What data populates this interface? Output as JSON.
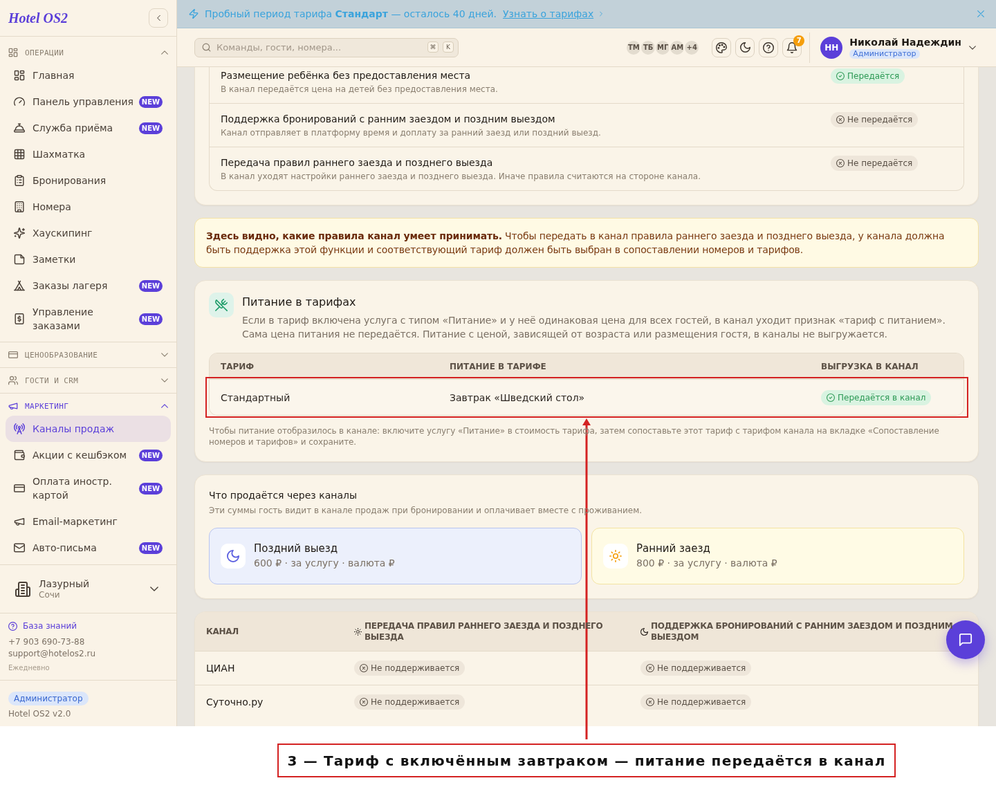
{
  "sidebar": {
    "logo": "Hotel OS2",
    "sections": [
      {
        "title": "ОПЕРАЦИИ",
        "expanded": true,
        "active": false,
        "items": [
          {
            "label": "Главная",
            "selected": false
          },
          {
            "label": "Панель управления",
            "selected": false,
            "badge": "NEW"
          },
          {
            "label": "Служба приёма",
            "selected": false,
            "badge": "NEW"
          },
          {
            "label": "Шахматка",
            "selected": false
          },
          {
            "label": "Бронирования",
            "selected": false
          },
          {
            "label": "Номера",
            "selected": false
          },
          {
            "label": "Хаускипинг",
            "selected": false
          },
          {
            "label": "Заметки",
            "selected": false
          },
          {
            "label": "Заказы лагеря",
            "selected": false,
            "badge": "NEW"
          },
          {
            "label": "Управление заказами",
            "selected": false,
            "badge": "NEW"
          }
        ]
      },
      {
        "title": "ЦЕНООБРАЗОВАНИЕ",
        "expanded": false,
        "active": false
      },
      {
        "title": "ГОСТИ И CRM",
        "expanded": false,
        "active": false
      },
      {
        "title": "МАРКЕТИНГ",
        "expanded": true,
        "active": true,
        "items": [
          {
            "label": "Каналы продаж",
            "selected": true
          },
          {
            "label": "Акции с кешбэком",
            "selected": false,
            "badge": "NEW"
          },
          {
            "label": "Оплата иностр. картой",
            "selected": false,
            "badge": "NEW"
          },
          {
            "label": "Email-маркетинг",
            "selected": false
          },
          {
            "label": "Авто-письма",
            "selected": false,
            "badge": "NEW"
          }
        ]
      }
    ],
    "hotel": {
      "name": "Лазурный",
      "city": "Сочи"
    },
    "support": {
      "link": "База знаний",
      "phone": "+7 903 690-73-88",
      "email": "support@hotelos2.ru",
      "hours": "Ежедневно"
    },
    "footer": {
      "role": "Администратор",
      "version": "Hotel OS2 v2.0"
    }
  },
  "banner": {
    "message": "Пробный период тарифа **Стандарт** — осталось 40 дней.",
    "link": "Узнать о тарифах"
  },
  "topbar": {
    "search": {
      "placeholder": "Команды, гости, номера...",
      "shortcut": [
        "⌘",
        "K"
      ]
    },
    "team": {
      "members": [
        "ТМ",
        "ТБ",
        "МГ",
        "АМ"
      ],
      "more": "+4"
    },
    "notifications": "7",
    "user": {
      "initials": "НН",
      "name": "Николай Надеждин",
      "role": "Администратор"
    }
  },
  "rules": {
    "rows": [
      {
        "title": "Размещение ребёнка без предоставления места",
        "description": "В канал передаётся цена на детей без предоставления места.",
        "status": "Передаётся",
        "transmitted": true
      },
      {
        "title": "Поддержка бронирований с ранним заездом и поздним выездом",
        "description": "Канал отправляет в платформу время и доплату за ранний заезд или поздний выезд.",
        "status": "Не передаётся",
        "transmitted": false
      },
      {
        "title": "Передача правил раннего заезда и позднего выезда",
        "description": "В канал уходят настройки раннего заезда и позднего выезда. Иначе правила считаются на стороне канала.",
        "status": "Не передаётся",
        "transmitted": false
      }
    ]
  },
  "notice": {
    "text": "**Здесь видно, какие правила канал умеет принимать.** Чтобы передать в канал правила раннего заезда и позднего выезда, у канала должна быть поддержка этой функции и соответствующий тариф должен быть выбран в сопоставлении номеров и тарифов."
  },
  "meals": {
    "title": "Питание в тарифах",
    "description": "Если в тариф включена услуга с типом «Питание» и у неё одинаковая цена для всех гостей, в канал уходит признак «тариф с питанием». Сама цена питания не передаётся. Питание с ценой, зависящей от возраста или размещения гостя, в каналы не выгружается.",
    "table": {
      "columns": [
        "ТАРИФ",
        "ПИТАНИЕ В ТАРИФЕ",
        "ВЫГРУЗКА В КАНАЛ"
      ],
      "rows": [
        {
          "tariff": "Стандартный",
          "meal": "Завтрак «Шведский стол»",
          "status": "Передаётся в канал",
          "transmitted": true,
          "highlighted": true
        }
      ]
    },
    "note": "Чтобы питание отобразилось в канале: включите услугу «Питание» в стоимость тарифа, затем сопоставьте этот тариф с тарифом канала на вкладке «Сопоставление номеров и тарифов» и сохраните."
  },
  "sold": {
    "title": "Что продаётся через каналы",
    "subtitle": "Эти суммы гость видит в канале продаж при бронировании и оплачивает вместе с проживанием.",
    "services": [
      {
        "kind": "late",
        "title": "Поздний выезд",
        "price": "600 ₽ · за услугу · валюта ₽"
      },
      {
        "kind": "early",
        "title": "Ранний заезд",
        "price": "800 ₽ · за услугу · валюта ₽"
      }
    ]
  },
  "channels": {
    "columns": [
      {
        "kind": "plain",
        "label": "КАНАЛ"
      },
      {
        "kind": "early",
        "label": "ПЕРЕДАЧА ПРАВИЛ РАННЕГО ЗАЕЗДА И ПОЗДНЕГО ВЫЕЗДА"
      },
      {
        "kind": "late",
        "label": "ПОДДЕРЖКА БРОНИРОВАНИЙ С РАННИМ ЗАЕЗДОМ И ПОЗДНИМ ВЫЕЗДОМ"
      }
    ],
    "rows": [
      {
        "cells": [
          {
            "kind": "name",
            "text": "ЦИАН"
          },
          {
            "kind": "status",
            "status": "Не поддерживается",
            "supported": false
          },
          {
            "kind": "status",
            "status": "Не поддерживается",
            "supported": false
          }
        ]
      },
      {
        "cells": [
          {
            "kind": "name",
            "text": "Суточно.ру"
          },
          {
            "kind": "status",
            "status": "Не поддерживается",
            "supported": false
          },
          {
            "kind": "status",
            "status": "Не поддерживается",
            "supported": false
          }
        ]
      }
    ]
  },
  "annotation": {
    "caption": "3 — Тариф с включённым завтраком — питание передаётся в канал"
  }
}
